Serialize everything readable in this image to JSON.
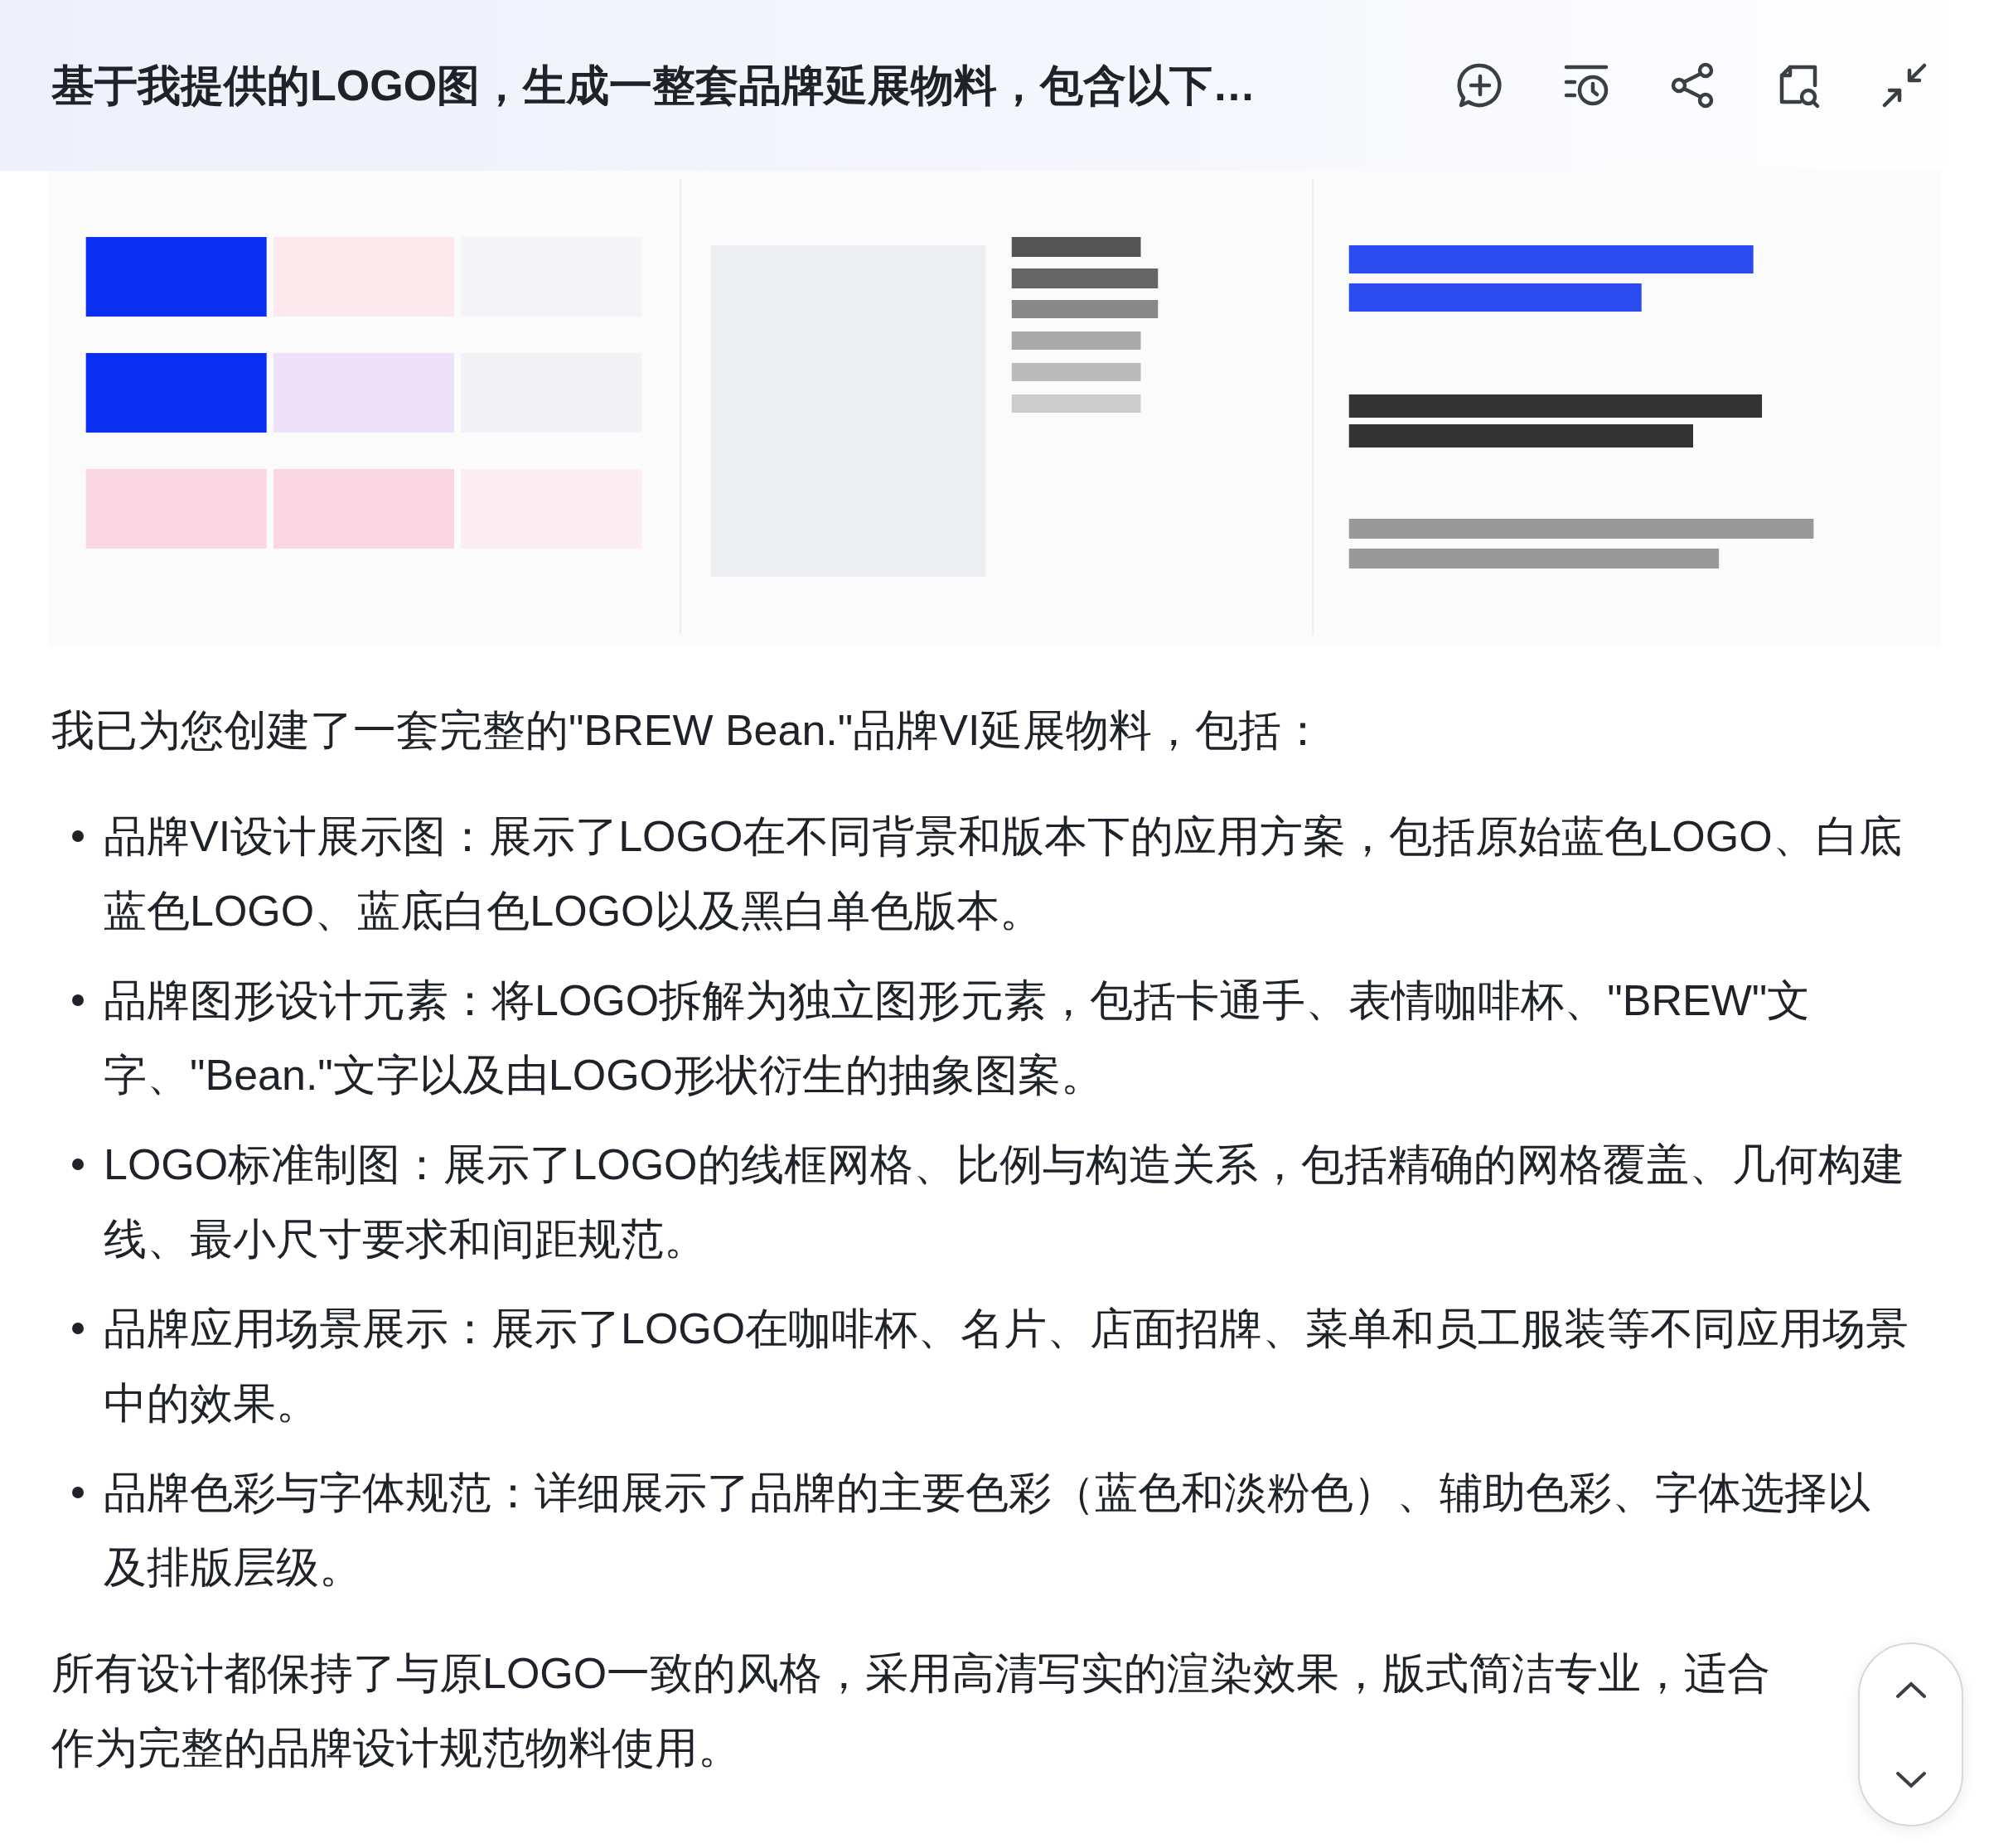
{
  "header": {
    "title": "基于我提供的LOGO图，生成一整套品牌延展物料，包含以下…"
  },
  "intro": "我已为您创建了一套完整的\"BREW Bean.\"品牌VI延展物料，包括：",
  "bullets": [
    "品牌VI设计展示图：展示了LOGO在不同背景和版本下的应用方案，包括原始蓝色LOGO、白底蓝色LOGO、蓝底白色LOGO以及黑白单色版本。",
    "品牌图形设计元素：将LOGO拆解为独立图形元素，包括卡通手、表情咖啡杯、\"BREW\"文字、\"Bean.\"文字以及由LOGO形状衍生的抽象图案。",
    "LOGO标准制图：展示了LOGO的线框网格、比例与构造关系，包括精确的网格覆盖、几何构建线、最小尺寸要求和间距规范。",
    "品牌应用场景展示：展示了LOGO在咖啡杯、名片、店面招牌、菜单和员工服装等不同应用场景中的效果。",
    "品牌色彩与字体规范：详细展示了品牌的主要色彩（蓝色和淡粉色）、辅助色彩、字体选择以及排版层级。"
  ],
  "closing": "所有设计都保持了与原LOGO一致的风格，采用高清写实的渲染效果，版式简洁专业，适合作为完整的品牌设计规范物料使用。"
}
